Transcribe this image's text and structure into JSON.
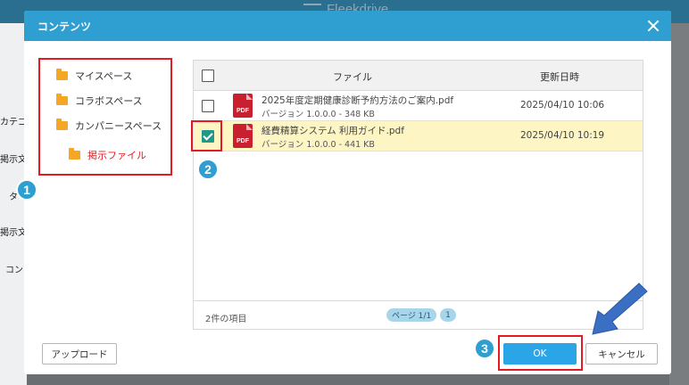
{
  "background": {
    "app_name": "Fleekdrive",
    "side_labels": [
      "カテゴ",
      "掲示文",
      "タ",
      "掲示文",
      "コン"
    ]
  },
  "dialog": {
    "title": "コンテンツ",
    "tree": [
      {
        "label": "マイスペース",
        "active": false
      },
      {
        "label": "コラボスペース",
        "active": false
      },
      {
        "label": "カンパニースペース",
        "active": false
      },
      {
        "label": "掲示ファイル",
        "active": true
      }
    ],
    "table": {
      "header_file": "ファイル",
      "header_date": "更新日時",
      "rows": [
        {
          "name": "2025年度定期健康診断予約方法のご案内.pdf",
          "meta": "バージョン 1.0.0.0 - 348 KB",
          "date": "2025/04/10 10:06",
          "checked": false,
          "icon": "PDF"
        },
        {
          "name": "経費精算システム 利用ガイド.pdf",
          "meta": "バージョン 1.0.0.0 - 441 KB",
          "date": "2025/04/10 10:19",
          "checked": true,
          "icon": "PDF"
        }
      ],
      "count": "2件の項目",
      "page_label": "ページ 1/1",
      "page_number": "1"
    },
    "buttons": {
      "upload": "アップロード",
      "ok": "OK",
      "cancel": "キャンセル"
    }
  },
  "badges": [
    "1",
    "2",
    "3"
  ],
  "colors": {
    "header": "#2f9ed1",
    "highlight": "#e51b23",
    "folder": "#f5a623",
    "check": "#1f9a8a",
    "selected_row": "#fdf5c3",
    "ok_button": "#2aa6e8",
    "arrow": "#3a6fc4"
  }
}
